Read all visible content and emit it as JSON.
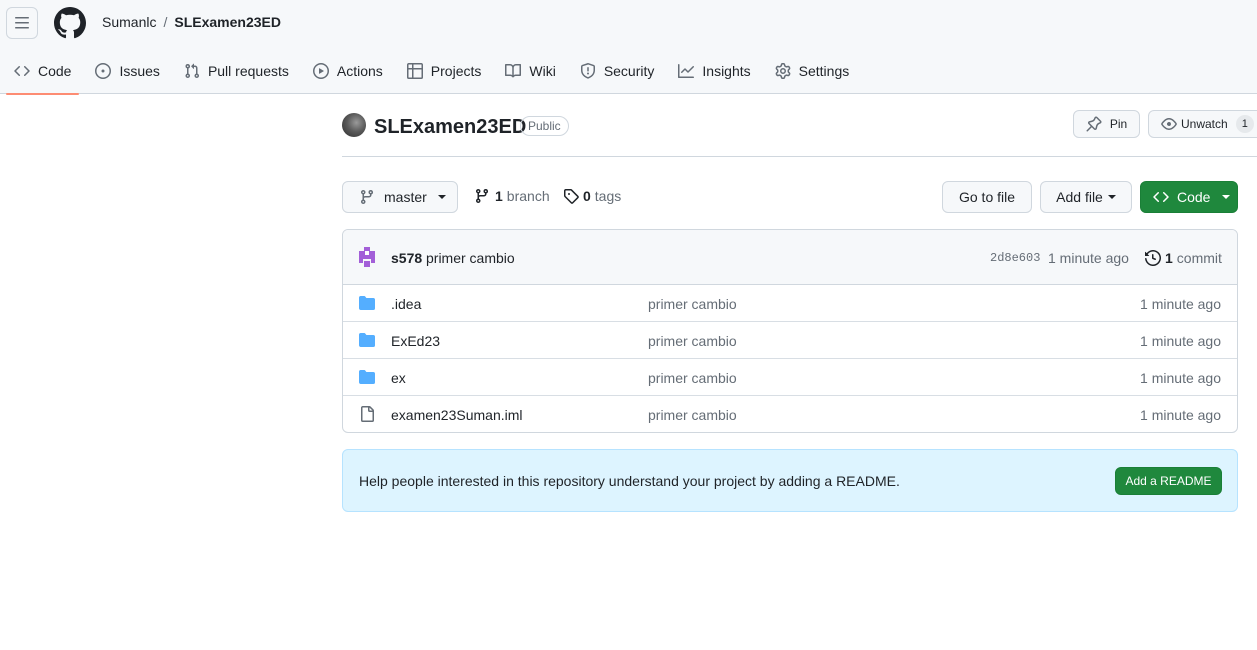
{
  "header": {
    "owner": "Sumanlc",
    "separator": "/",
    "repo": "SLExamen23ED",
    "logo_icon": "github-mark-icon",
    "menu_icon": "hamburger-menu-icon"
  },
  "tabs": [
    {
      "label": "Code",
      "icon": "code-icon",
      "selected": true
    },
    {
      "label": "Issues",
      "icon": "issue-opened-icon"
    },
    {
      "label": "Pull requests",
      "icon": "git-pull-request-icon"
    },
    {
      "label": "Actions",
      "icon": "play-icon"
    },
    {
      "label": "Projects",
      "icon": "table-icon"
    },
    {
      "label": "Wiki",
      "icon": "book-icon"
    },
    {
      "label": "Security",
      "icon": "shield-icon"
    },
    {
      "label": "Insights",
      "icon": "graph-icon"
    },
    {
      "label": "Settings",
      "icon": "gear-icon"
    }
  ],
  "repo_title": {
    "name": "SLExamen23ED",
    "visibility": "Public",
    "pin_label": "Pin",
    "unwatch_label": "Unwatch",
    "watch_count": "1"
  },
  "toolbar": {
    "branch": "master",
    "branch_count": "1",
    "branch_word": "branch",
    "tag_count": "0",
    "tag_word": "tags",
    "goto_file": "Go to file",
    "add_file": "Add file",
    "code_button": "Code"
  },
  "latest_commit": {
    "author": "s578",
    "message": "primer cambio",
    "sha": "2d8e603",
    "time": "1 minute ago",
    "commit_count": "1",
    "commit_word": "commit"
  },
  "files": [
    {
      "type": "folder",
      "name": ".idea",
      "message": "primer cambio",
      "time": "1 minute ago"
    },
    {
      "type": "folder",
      "name": "ExEd23",
      "message": "primer cambio",
      "time": "1 minute ago"
    },
    {
      "type": "folder",
      "name": "ex",
      "message": "primer cambio",
      "time": "1 minute ago"
    },
    {
      "type": "file",
      "name": "examen23Suman.iml",
      "message": "primer cambio",
      "time": "1 minute ago"
    }
  ],
  "readme_banner": {
    "text": "Help people interested in this repository understand your project by adding a README.",
    "button": "Add a README"
  },
  "colors": {
    "accent_green": "#1f883d",
    "tab_underline": "#fd8c73",
    "folder_blue": "#54aeff",
    "banner_bg": "#ddf4ff"
  }
}
